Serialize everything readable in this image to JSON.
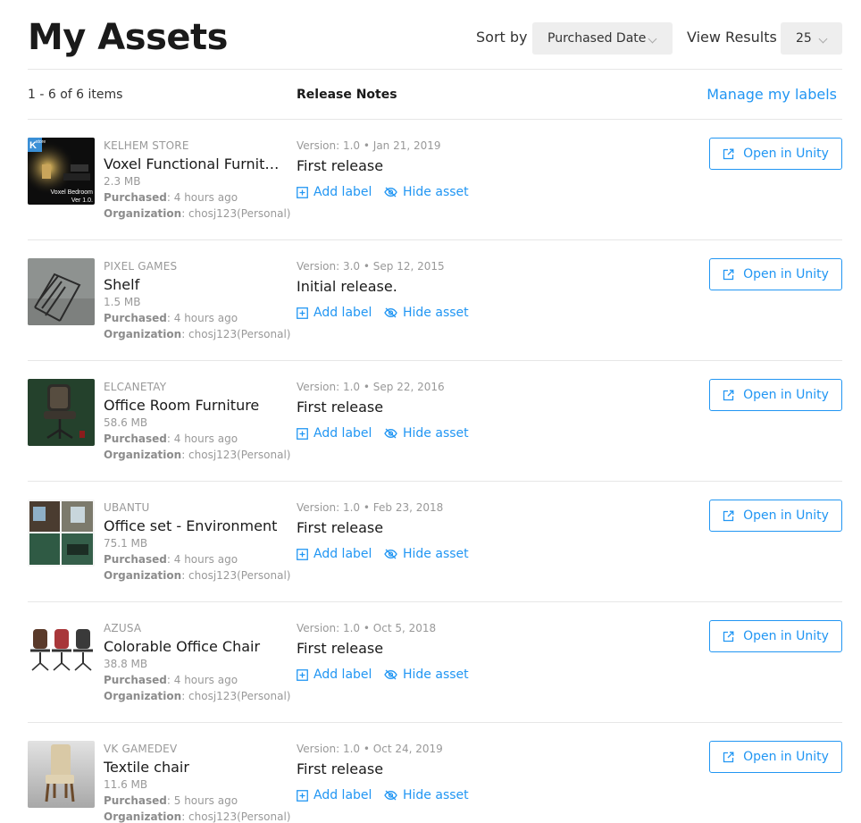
{
  "header": {
    "title": "My Assets",
    "sort_label": "Sort by",
    "sort_value": "Purchased Date",
    "view_label": "View Results",
    "view_value": "25"
  },
  "subheader": {
    "item_count": "1 - 6 of 6 items",
    "release_notes_label": "Release Notes",
    "manage_labels": "Manage my labels"
  },
  "actions": {
    "add_label": "Add label",
    "hide_asset": "Hide asset",
    "open_in_unity": "Open in Unity",
    "purchased_label": "Purchased",
    "organization_label": "Organization"
  },
  "assets": [
    {
      "publisher": "KELHEM STORE",
      "name": "Voxel Functional Furniture",
      "size": "2.3 MB",
      "purchased": ": 4 hours ago",
      "organization": ": chosj123(Personal)",
      "version": "Version: 1.0 • Jan 21, 2019",
      "note": "First release",
      "thumb_text": "Voxel Bedroom Ver 1.0.",
      "thumb_logo": "K",
      "thumb_logo_sub": "store"
    },
    {
      "publisher": "PIXEL GAMES",
      "name": "Shelf",
      "size": "1.5 MB",
      "purchased": ": 4 hours ago",
      "organization": ": chosj123(Personal)",
      "version": "Version: 3.0 • Sep 12, 2015",
      "note": "Initial release."
    },
    {
      "publisher": "ELCANETAY",
      "name": "Office Room Furniture",
      "size": "58.6 MB",
      "purchased": ": 4 hours ago",
      "organization": ": chosj123(Personal)",
      "version": "Version: 1.0 • Sep 22, 2016",
      "note": "First release"
    },
    {
      "publisher": "UBANTU",
      "name": "Office set - Environment",
      "size": "75.1 MB",
      "purchased": ": 4 hours ago",
      "organization": ": chosj123(Personal)",
      "version": "Version: 1.0 • Feb 23, 2018",
      "note": "First release"
    },
    {
      "publisher": "AZUSA",
      "name": "Colorable Office Chair",
      "size": "38.8 MB",
      "purchased": ": 4 hours ago",
      "organization": ": chosj123(Personal)",
      "version": "Version: 1.0 • Oct 5, 2018",
      "note": "First release"
    },
    {
      "publisher": "VK GAMEDEV",
      "name": "Textile chair",
      "size": "11.6 MB",
      "purchased": ": 5 hours ago",
      "organization": ": chosj123(Personal)",
      "version": "Version: 1.0 • Oct 24, 2019",
      "note": "First release"
    }
  ],
  "colors": {
    "accent": "#2196f3",
    "muted": "#999999",
    "divider": "#e6e6e6"
  }
}
